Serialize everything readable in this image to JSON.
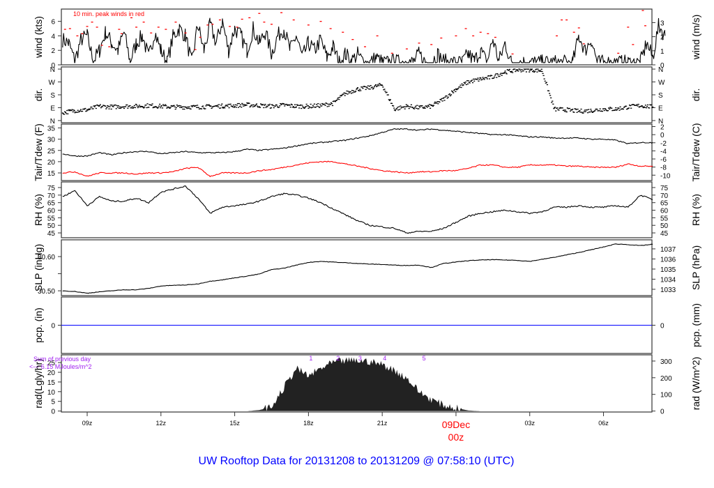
{
  "chart_data": {
    "type": "line",
    "title": "UW Rooftop Data for 20131208  to  20131209 @ 07:58:10  (UTC)",
    "x_unit": "hours UTC since 2013-12-08 00z",
    "xlim": [
      7.95,
      31.97
    ],
    "x_ticks": [
      {
        "t": 9,
        "label": "09z"
      },
      {
        "t": 12,
        "label": "12z"
      },
      {
        "t": 15,
        "label": "15z"
      },
      {
        "t": 18,
        "label": "18z"
      },
      {
        "t": 21,
        "label": "21z"
      },
      {
        "t": 24,
        "label": "00z",
        "date_label": "09Dec",
        "highlight": true
      },
      {
        "t": 27,
        "label": "03z"
      },
      {
        "t": 30,
        "label": "06z"
      }
    ],
    "t": [
      8,
      8.5,
      9,
      9.5,
      10,
      10.5,
      11,
      11.5,
      12,
      12.5,
      13,
      13.5,
      14,
      14.5,
      15,
      15.5,
      16,
      16.5,
      17,
      17.5,
      18,
      18.5,
      19,
      19.5,
      20,
      20.5,
      21,
      21.5,
      22,
      22.5,
      23,
      23.5,
      24,
      24.5,
      25,
      25.5,
      26,
      26.5,
      27,
      27.5,
      28,
      28.5,
      29,
      29.5,
      30,
      30.5,
      31,
      31.5,
      32
    ],
    "panels": {
      "wind": {
        "ylabel": "wind (kts)",
        "ylabel_right": "wind (m/s)",
        "ylim": [
          0,
          7.7
        ],
        "left_ticks": [
          0,
          2,
          4,
          6
        ],
        "right_ticks": [
          0,
          1,
          2,
          3
        ],
        "annotation": "10 min. peak winds in red",
        "series_color": "#000000",
        "gust_color": "#ff0000",
        "t_step": 0.25,
        "t_start": 8,
        "speed": [
          3.5,
          3,
          0.5,
          3.5,
          4,
          0.5,
          2,
          4.5,
          3,
          2,
          4.5,
          0.5,
          3,
          4,
          1,
          4.5,
          2,
          0.3,
          4,
          5,
          4,
          0.3,
          5.5,
          2,
          5.5,
          3,
          6,
          2,
          5,
          4,
          2,
          5,
          3,
          4.5,
          1.5,
          4,
          5,
          2,
          4,
          1,
          3,
          2,
          3.5,
          1,
          2.5,
          0.3,
          1.5,
          0.5,
          1.5,
          0.3,
          0.3,
          1,
          0.3,
          0.3,
          0.5,
          0.3,
          0.6,
          0.3,
          1.5,
          0.3,
          0.3,
          1.5,
          0.5,
          0.3,
          0.3,
          0.3,
          1.5,
          0.5,
          2,
          0.3,
          3.5,
          0.5,
          3,
          0.3,
          0.3,
          0.3,
          0.3,
          0.3,
          0.3,
          0.3,
          0.3,
          0.3,
          0.3,
          0.3,
          4,
          2,
          3.5,
          0.3,
          0.3,
          0.3,
          0.3,
          0.3,
          0.3,
          0.3,
          0.3,
          3,
          1,
          5.5,
          4
        ],
        "gusts": [
          [
            8.1,
            4.9
          ],
          [
            8.3,
            5.0
          ],
          [
            8.6,
            4.0
          ],
          [
            8.8,
            4.3
          ],
          [
            9.0,
            5.3
          ],
          [
            9.2,
            5.9
          ],
          [
            9.4,
            5.2
          ],
          [
            9.6,
            2.7
          ],
          [
            9.9,
            2.5
          ],
          [
            10.3,
            4.9
          ],
          [
            10.4,
            4.3
          ],
          [
            10.8,
            6.5
          ],
          [
            11.0,
            5.2
          ],
          [
            11.3,
            5.9
          ],
          [
            11.6,
            4.4
          ],
          [
            11.9,
            5.2
          ],
          [
            12.2,
            4.9
          ],
          [
            12.6,
            5.9
          ],
          [
            13.0,
            4.4
          ],
          [
            13.4,
            2.1
          ],
          [
            13.6,
            3.8
          ],
          [
            13.9,
            5.5
          ],
          [
            14.1,
            5.6
          ],
          [
            14.4,
            6.2
          ],
          [
            14.8,
            5.3
          ],
          [
            15.1,
            5.2
          ],
          [
            15.3,
            6.3
          ],
          [
            15.6,
            6.5
          ],
          [
            16.0,
            7.1
          ],
          [
            16.2,
            5.9
          ],
          [
            16.5,
            5.6
          ],
          [
            16.9,
            7.2
          ],
          [
            17.4,
            6.2
          ],
          [
            18.0,
            5.5
          ],
          [
            18.5,
            6.0
          ],
          [
            18.9,
            5.0
          ],
          [
            19.4,
            4.5
          ],
          [
            19.8,
            3.5
          ],
          [
            20.3,
            2.5
          ],
          [
            20.8,
            4.0
          ],
          [
            21.4,
            1.6
          ],
          [
            22.0,
            2.2
          ],
          [
            22.5,
            3.0
          ],
          [
            23.0,
            2.8
          ],
          [
            23.4,
            3.7
          ],
          [
            24.0,
            4.0
          ],
          [
            24.4,
            5.0
          ],
          [
            24.7,
            4.0
          ],
          [
            25.0,
            4.5
          ],
          [
            25.3,
            4.3
          ],
          [
            25.6,
            3.8
          ],
          [
            26.3,
            1.5
          ],
          [
            28.1,
            4.0
          ],
          [
            28.3,
            6.2
          ],
          [
            28.5,
            6.2
          ],
          [
            28.8,
            4.5
          ],
          [
            29.0,
            5.1
          ],
          [
            29.2,
            2.9
          ],
          [
            30.6,
            1.6
          ],
          [
            31.0,
            5.2
          ],
          [
            31.2,
            2.8
          ],
          [
            31.6,
            7.5
          ],
          [
            31.7,
            5.4
          ]
        ]
      },
      "dir": {
        "ylabel": "dir.",
        "ylabel_right": "dir.",
        "ylim": [
          -15,
          375
        ],
        "ticks": [
          {
            "v": 0,
            "label": "N"
          },
          {
            "v": 90,
            "label": "E"
          },
          {
            "v": 180,
            "label": "S"
          },
          {
            "v": 270,
            "label": "W"
          },
          {
            "v": 360,
            "label": "N"
          }
        ],
        "degrees": [
          55,
          70,
          75,
          100,
          95,
          100,
          100,
          105,
          100,
          95,
          95,
          95,
          98,
          102,
          105,
          110,
          105,
          100,
          108,
          100,
          100,
          105,
          120,
          190,
          220,
          230,
          250,
          80,
          100,
          90,
          100,
          150,
          220,
          270,
          290,
          305,
          340,
          355,
          355,
          350,
          80,
          75,
          65,
          70,
          80,
          80,
          95,
          105,
          95
        ]
      },
      "temp": {
        "ylabel": "Tair/Tdew (F)",
        "ylabel_right": "Tair/Tdew (C)",
        "ylim": [
          11.6,
          36.7
        ],
        "left_ticks": [
          15,
          20,
          25,
          30,
          35
        ],
        "right_ticks": [
          2,
          0,
          -2,
          -4,
          -6,
          -8,
          -10
        ],
        "tair_color": "#000000",
        "tdew_color": "#ff0000",
        "tair": [
          23.5,
          22.5,
          22.5,
          24,
          23,
          24,
          24.5,
          24.5,
          23.5,
          24,
          24.5,
          24,
          24,
          24,
          24.5,
          25.5,
          25,
          25.5,
          26,
          27,
          28,
          28.5,
          29,
          29.5,
          30.5,
          31.5,
          33,
          34.5,
          34.5,
          34,
          34.5,
          34,
          33.5,
          33,
          32.5,
          32,
          32,
          31.5,
          31,
          31,
          30.5,
          30.5,
          30.5,
          30,
          30,
          29.5,
          28,
          28.5,
          28.5
        ],
        "tdew": [
          15,
          15.5,
          13.5,
          15,
          15,
          15,
          14.5,
          15,
          15,
          15.5,
          17,
          17.5,
          13.5,
          15,
          15,
          15,
          16,
          16.5,
          17.5,
          18.5,
          19.5,
          20,
          20,
          19,
          18,
          17,
          16,
          15.5,
          15,
          15.5,
          15.5,
          16,
          16,
          17,
          18.5,
          18.5,
          17.5,
          17.5,
          18.5,
          18.5,
          18.5,
          18,
          18,
          17.5,
          17.5,
          17.5,
          19,
          18,
          18
        ]
      },
      "rh": {
        "ylabel": "RH (%)",
        "ylabel_right": "RH (%)",
        "ylim": [
          41.8,
          78.7
        ],
        "left_ticks": [
          45,
          50,
          55,
          60,
          65,
          70,
          75
        ],
        "right_ticks": [
          45,
          50,
          55,
          60,
          65,
          70,
          75
        ],
        "values": [
          69,
          73,
          63,
          69,
          66,
          66,
          68,
          65,
          72,
          74,
          76,
          68,
          58,
          62,
          63,
          64,
          66,
          69,
          71,
          70,
          68,
          65,
          61,
          57,
          53,
          50,
          49,
          48,
          45,
          46,
          46,
          48,
          52,
          56,
          58,
          59,
          60,
          59,
          58,
          59,
          62,
          62,
          63,
          62,
          62,
          63,
          62,
          70,
          67
        ]
      },
      "slp": {
        "ylabel": "SLP (inHg)",
        "ylabel_right": "SLP (hPa)",
        "ylim": [
          30.486,
          30.649
        ],
        "left_ticks": [
          30.5,
          30.55,
          30.6
        ],
        "left_tick_labels": [
          "30.50",
          "",
          "30.60"
        ],
        "right_ticks": [
          1033,
          1034,
          1035,
          1036,
          1037
        ],
        "values": [
          30.5,
          30.498,
          30.493,
          30.497,
          30.5,
          30.503,
          30.503,
          30.507,
          30.514,
          30.516,
          30.517,
          30.52,
          30.528,
          30.532,
          30.538,
          30.543,
          30.549,
          30.562,
          30.566,
          30.575,
          30.583,
          30.586,
          30.584,
          30.582,
          30.58,
          30.578,
          30.577,
          30.575,
          30.574,
          30.575,
          30.568,
          30.58,
          30.584,
          30.588,
          30.59,
          30.591,
          30.59,
          30.589,
          30.586,
          30.592,
          30.598,
          30.605,
          30.612,
          30.62,
          30.628,
          30.637,
          30.635,
          30.632,
          30.636
        ]
      },
      "pcp": {
        "ylabel": "pcp. (in)",
        "ylabel_right": "pcp. (mm)",
        "ylim": [
          -1,
          1
        ],
        "left_ticks": [
          0
        ],
        "right_ticks": [
          0
        ],
        "line_color": "#0000ff",
        "value": 0
      },
      "rad": {
        "ylabel": "rad(Lgly/hr)",
        "ylabel_right": "rad (W/m^2)",
        "ylim": [
          -0.5,
          29
        ],
        "left_ticks": [
          0,
          5,
          10,
          15,
          20,
          25
        ],
        "right_ticks": [
          0,
          100,
          200,
          300
        ],
        "fill_color": "#222222",
        "values": [
          0,
          0,
          0,
          0,
          0,
          0,
          0,
          0,
          0,
          0,
          0,
          0,
          0,
          0,
          0,
          0,
          0.5,
          2,
          12,
          22,
          18,
          22,
          25,
          26,
          26,
          25.5,
          24,
          21,
          17,
          10,
          6,
          3,
          1.5,
          0.3,
          0,
          0,
          0,
          0,
          0,
          0,
          0,
          0,
          0,
          0,
          0,
          0,
          0,
          0,
          0
        ],
        "note_line1": "Sum of previous day",
        "note_line2": "<--- 6.15 MJoules/m^2",
        "note_color": "#a020f0",
        "hour_markers": [
          {
            "t": 18.1,
            "label": "1"
          },
          {
            "t": 19.2,
            "label": "2"
          },
          {
            "t": 20.1,
            "label": "3"
          },
          {
            "t": 21.1,
            "label": "4"
          },
          {
            "t": 22.7,
            "label": "5"
          }
        ]
      }
    }
  }
}
